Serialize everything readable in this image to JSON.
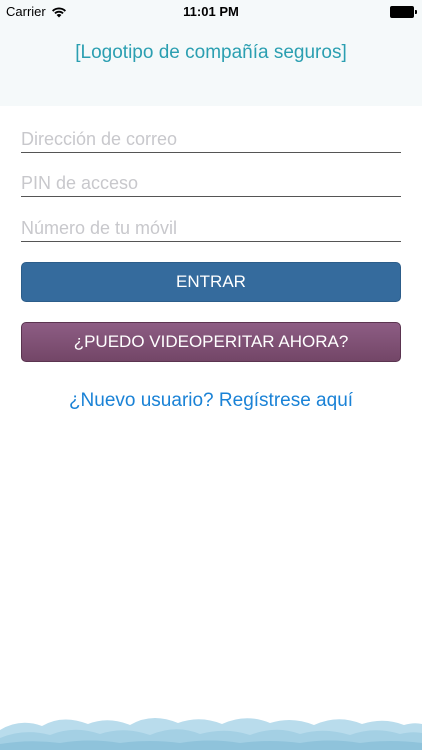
{
  "status_bar": {
    "carrier": "Carrier",
    "time": "11:01 PM"
  },
  "header": {
    "logo_text": "[Logotipo de compañía seguros]"
  },
  "form": {
    "email_placeholder": "Dirección de correo",
    "pin_placeholder": "PIN de acceso",
    "phone_placeholder": "Número de tu móvil"
  },
  "buttons": {
    "login_label": "ENTRAR",
    "video_label": "¿PUEDO VIDEOPERITAR AHORA?"
  },
  "register_link": "¿Nuevo usuario? Regístrese aquí",
  "colors": {
    "accent_teal": "#2b9fb1",
    "login_button": "#356b9d",
    "video_button": "#7d4f74",
    "link_blue": "#1a82d6"
  }
}
